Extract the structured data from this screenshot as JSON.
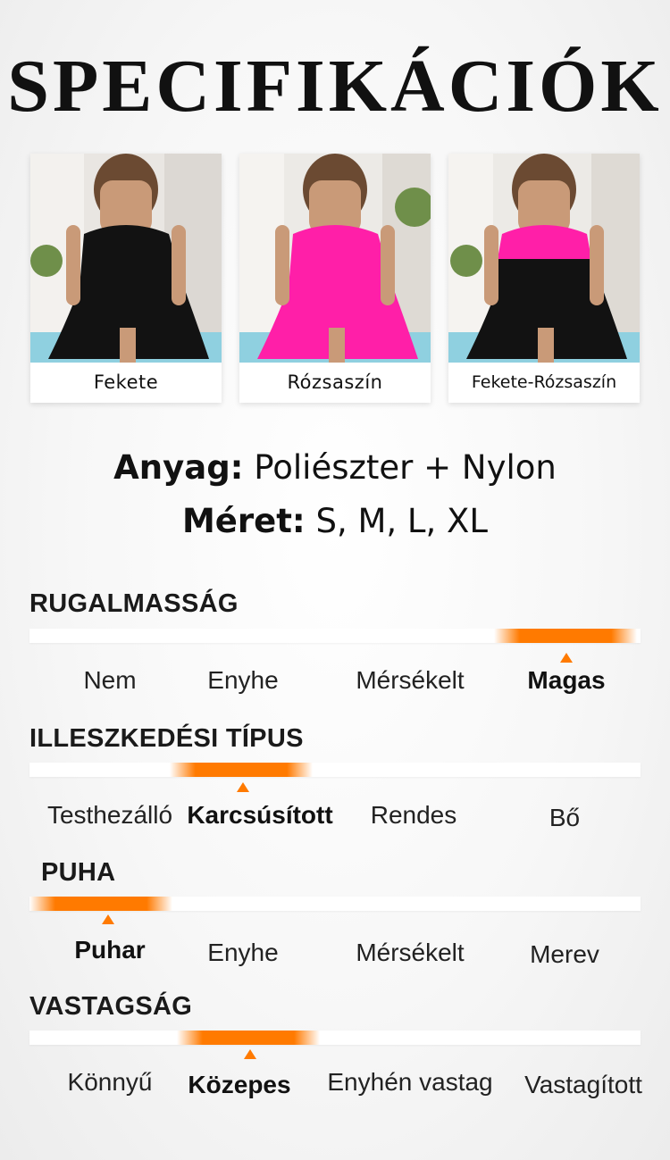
{
  "title": "SPECIFIKÁCIÓK",
  "colors": [
    {
      "label": "Fekete",
      "swatch": "#121212"
    },
    {
      "label": "Rózsaszín",
      "swatch": "#ff1fa8"
    },
    {
      "label": "Fekete-Rózsaszín",
      "swatch": "#ff1fa8"
    }
  ],
  "material": {
    "label": "Anyag:",
    "value": "Poliészter + Nylon"
  },
  "size": {
    "label": "Méret:",
    "value": "S, M, L, XL"
  },
  "accent_color": "#ff7a00",
  "sections": [
    {
      "title": "RUGALMASSÁG",
      "options": [
        "Nem",
        "Enyhe",
        "Mérsékelt",
        "Magas"
      ],
      "selected": "Magas",
      "selected_index": 3
    },
    {
      "title": "ILLESZKEDÉSI TÍPUS",
      "options": [
        "Testhezálló",
        "Karcsúsított",
        "Rendes",
        "Bő"
      ],
      "selected": "Karcsúsított",
      "selected_index": 1
    },
    {
      "title": "PUHA",
      "options": [
        "Puhar",
        "Enyhe",
        "Mérsékelt",
        "Merev"
      ],
      "selected": "Puhar",
      "selected_index": 0
    },
    {
      "title": "VASTAGSÁG",
      "options": [
        "Könnyű",
        "Közepes",
        "Enyhén vastag",
        "Vastagított"
      ],
      "selected": "Közepes",
      "selected_index": 1
    }
  ]
}
